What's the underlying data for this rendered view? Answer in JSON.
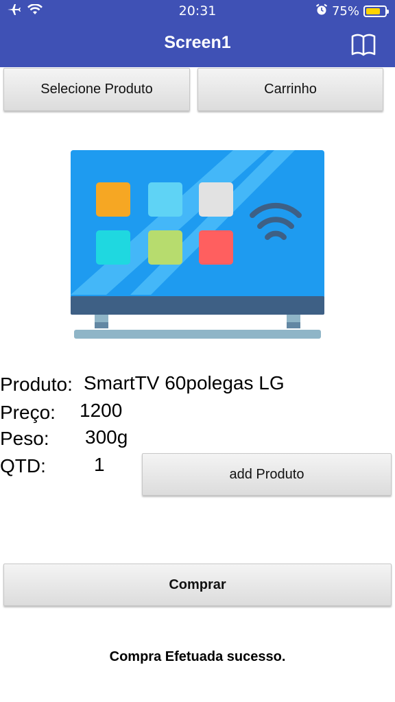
{
  "status_bar": {
    "time": "20:31",
    "battery_text": "75%",
    "battery_level": 0.75,
    "icons": [
      "airplane-icon",
      "wifi-icon",
      "alarm-icon",
      "battery-icon"
    ]
  },
  "header": {
    "title": "Screen1",
    "background": "#3f51b5",
    "action_icon": "book-icon"
  },
  "toolbar": {
    "select_label": "Selecione Produto",
    "cart_label": "Carrinho"
  },
  "product_image": {
    "icon": "smart-tv-icon",
    "colors": {
      "screen": "#1e9bf0",
      "app1": "#f6a723",
      "app2": "#5fd3f5",
      "app3": "#e2e2e2",
      "app4": "#1fd8e0",
      "app5": "#b7dc6e",
      "app6": "#ff5f5f",
      "bezel": "#3e6085",
      "stand": "#8fb5c7"
    }
  },
  "product": {
    "name_label": "Produto:",
    "name_value": "SmartTV 60polegas LG",
    "price_label": "Preço:",
    "price_value": "1200",
    "weight_label": "Peso:",
    "weight_value": "300g",
    "qty_label": "QTD:",
    "qty_value": "1"
  },
  "actions": {
    "add_label": "add Produto",
    "buy_label": "Comprar"
  },
  "message": "Compra Efetuada sucesso."
}
